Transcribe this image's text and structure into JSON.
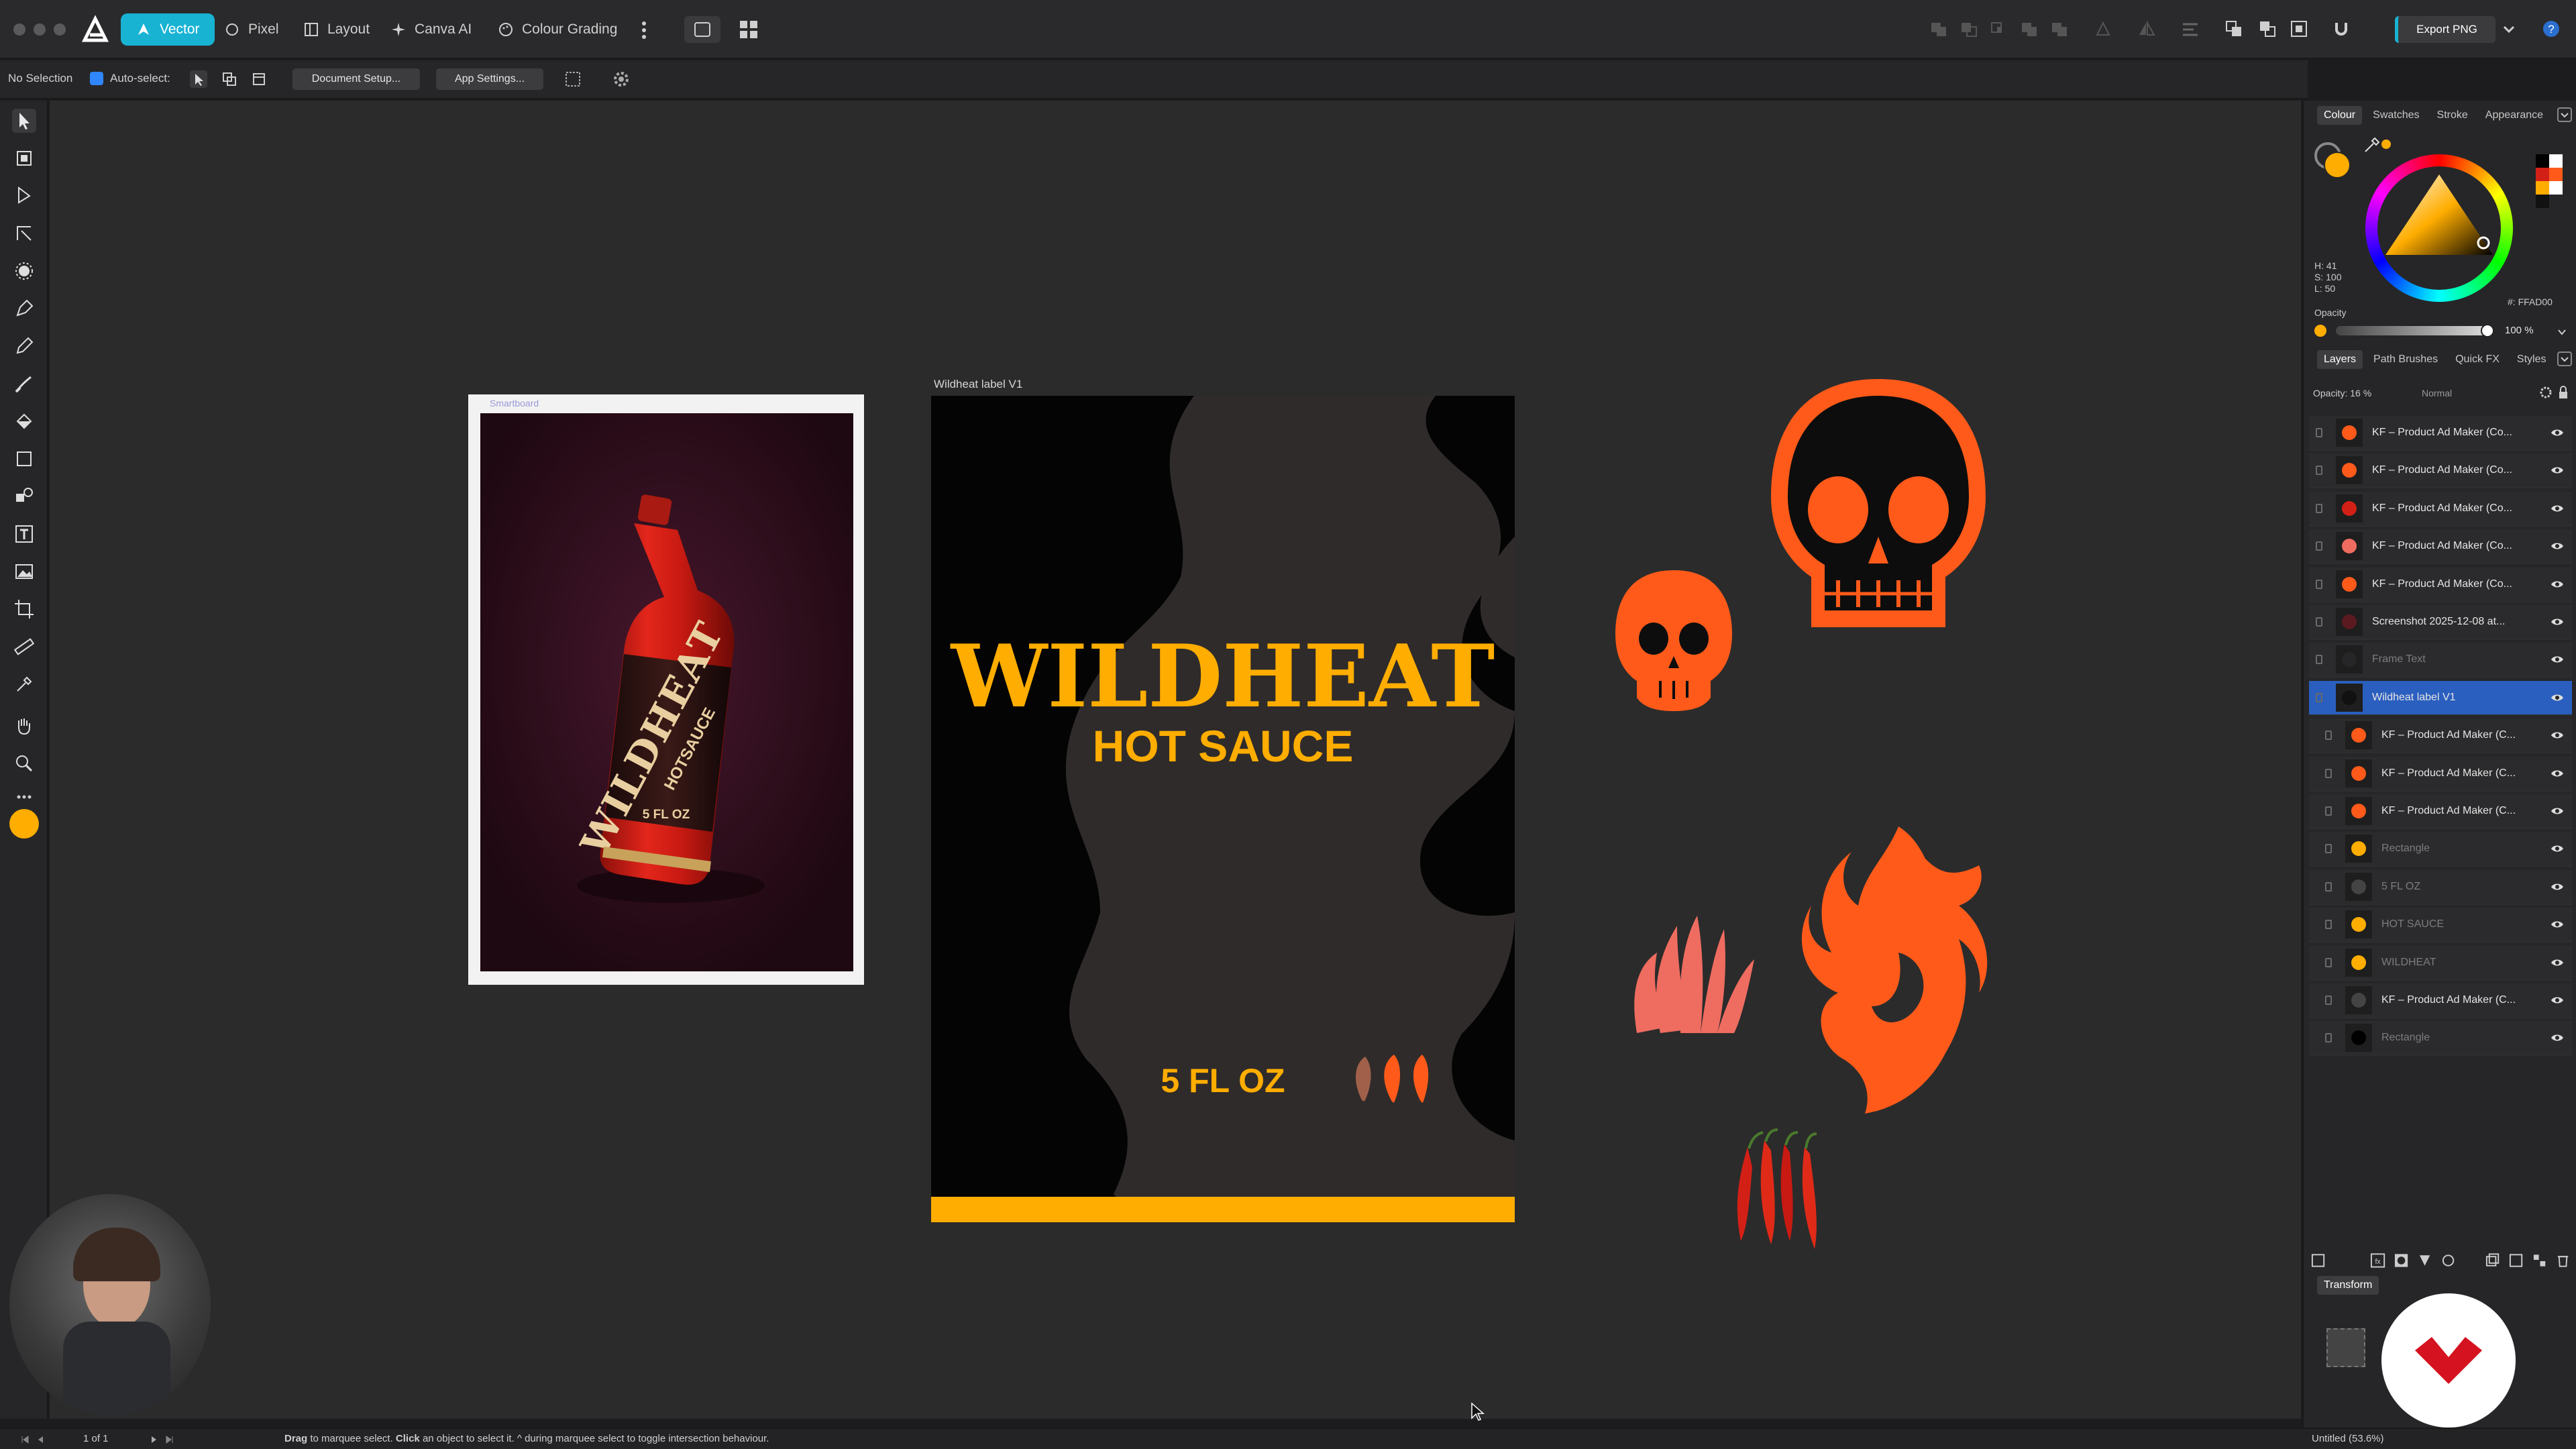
{
  "personas": [
    {
      "label": "Vector",
      "active": true
    },
    {
      "label": "Pixel",
      "active": false
    },
    {
      "label": "Layout",
      "active": false
    },
    {
      "label": "Canva AI",
      "active": false
    },
    {
      "label": "Colour Grading",
      "active": false
    }
  ],
  "export_label": "Export PNG",
  "context": {
    "selection": "No Selection",
    "auto_select": "Auto-select:",
    "doc_setup": "Document Setup...",
    "app_settings": "App Settings..."
  },
  "canvas": {
    "smartboard_label": "Smartboard",
    "artboard_label": "Wildheat label V1",
    "label_title": "WILDHEAT",
    "label_subtitle": "HOT SAUCE",
    "label_volume": "5 FL OZ",
    "bottle_brand": "WILDHEAT",
    "bottle_sub": "HOTSAUCE",
    "bottle_vol": "5 FL OZ"
  },
  "colour_panel": {
    "tabs": [
      "Colour",
      "Swatches",
      "Stroke",
      "Appearance"
    ],
    "h": "H: 41",
    "s": "S: 100",
    "l": "L: 50",
    "hex": "#: FFAD00",
    "opacity_label": "Opacity",
    "opacity_value": "100 %",
    "accent": "#ffad00"
  },
  "layers_panel": {
    "tabs": [
      "Layers",
      "Path Brushes",
      "Quick FX",
      "Styles"
    ],
    "opacity": "Opacity: 16 %",
    "blend": "Normal",
    "rows": [
      {
        "name": "KF – Product Ad Maker (Co...",
        "dim": false,
        "child": false,
        "selected": false
      },
      {
        "name": "KF – Product Ad Maker (Co...",
        "dim": false,
        "child": false,
        "selected": false
      },
      {
        "name": "KF – Product Ad Maker (Co...",
        "dim": false,
        "child": false,
        "selected": false
      },
      {
        "name": "KF – Product Ad Maker (Co...",
        "dim": false,
        "child": false,
        "selected": false
      },
      {
        "name": "KF – Product Ad Maker (Co...",
        "dim": false,
        "child": false,
        "selected": false
      },
      {
        "name": "Screenshot 2025-12-08 at...",
        "dim": false,
        "child": false,
        "selected": false
      },
      {
        "name": "Frame Text",
        "dim": true,
        "child": false,
        "selected": false
      },
      {
        "name": "Wildheat label V1",
        "dim": false,
        "child": false,
        "selected": true
      },
      {
        "name": "KF – Product Ad Maker (C...",
        "dim": false,
        "child": true,
        "selected": false
      },
      {
        "name": "KF – Product Ad Maker (C...",
        "dim": false,
        "child": true,
        "selected": false
      },
      {
        "name": "KF – Product Ad Maker (C...",
        "dim": false,
        "child": true,
        "selected": false
      },
      {
        "name": "Rectangle",
        "dim": true,
        "child": true,
        "selected": false
      },
      {
        "name": "5 FL OZ",
        "dim": true,
        "child": true,
        "selected": false
      },
      {
        "name": "HOT SAUCE",
        "dim": true,
        "child": true,
        "selected": false
      },
      {
        "name": "WILDHEAT",
        "dim": true,
        "child": true,
        "selected": false
      },
      {
        "name": "KF – Product Ad Maker (C...",
        "dim": false,
        "child": true,
        "selected": false
      },
      {
        "name": "Rectangle",
        "dim": true,
        "child": true,
        "selected": false
      }
    ]
  },
  "transform_label": "Transform",
  "status": {
    "pages": "1 of 1",
    "hint_drag": "Drag",
    "hint_1": " to marquee select. ",
    "hint_click": "Click",
    "hint_2": " an object to select it. ^ during marquee select to toggle intersection behaviour.",
    "doc": "Untitled (53.6%)"
  }
}
